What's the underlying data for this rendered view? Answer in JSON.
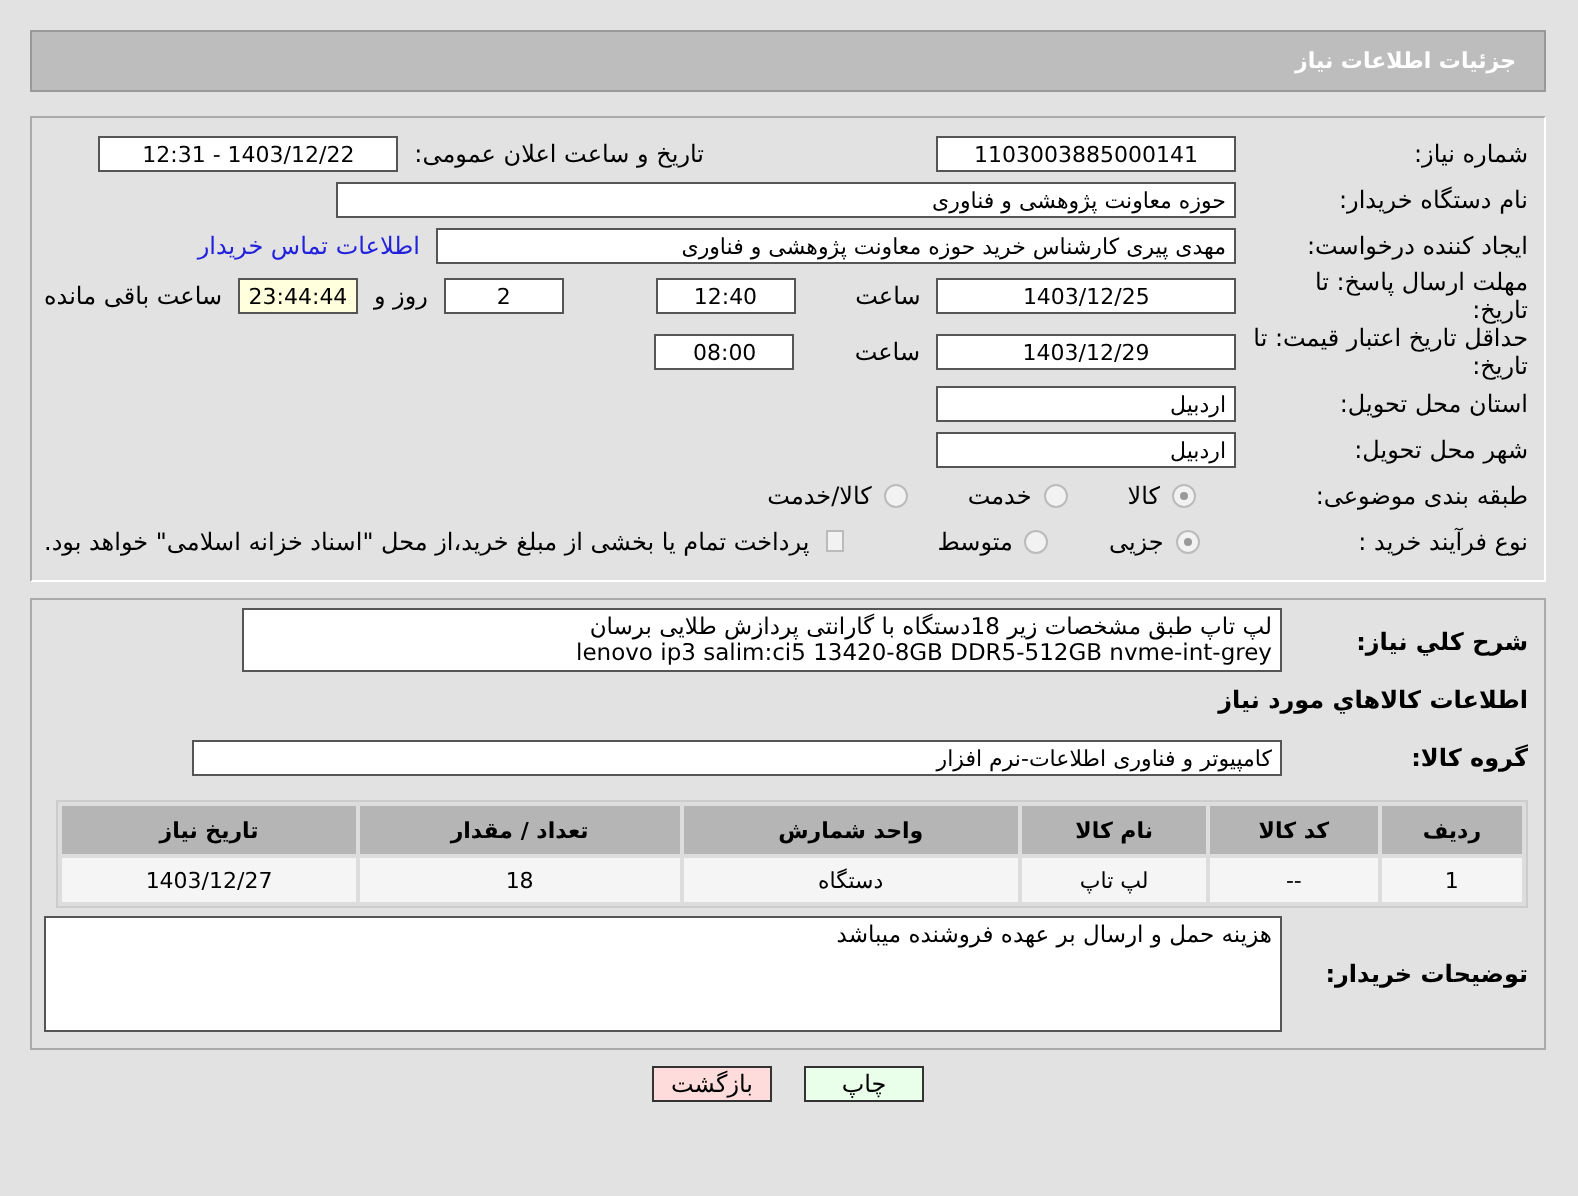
{
  "header": {
    "title": "جزئیات اطلاعات نیاز"
  },
  "fields": {
    "need_number": {
      "label": "شماره نیاز:",
      "value": "1103003885000141"
    },
    "announce": {
      "label": "تاریخ و ساعت اعلان عمومی:",
      "value": "1403/12/22 - 12:31"
    },
    "buyer_org": {
      "label": "نام دستگاه خریدار:",
      "value": "حوزه معاونت پژوهشی و فناوری"
    },
    "creator": {
      "label": "ایجاد کننده درخواست:",
      "value": "مهدی پیری کارشناس خرید حوزه معاونت پژوهشی و فناوری",
      "link": "اطلاعات تماس خریدار"
    },
    "deadline": {
      "label": "مهلت ارسال پاسخ: تا تاریخ:",
      "date": "1403/12/25",
      "time_label": "ساعت",
      "time": "12:40",
      "days": "2",
      "days_label": "روز و",
      "remaining": "23:44:44",
      "remaining_label": "ساعت باقی مانده"
    },
    "validity": {
      "label": "حداقل تاریخ اعتبار قیمت: تا تاریخ:",
      "date": "1403/12/29",
      "time_label": "ساعت",
      "time": "08:00"
    },
    "province": {
      "label": "استان محل تحویل:",
      "value": "اردبیل"
    },
    "city": {
      "label": "شهر محل تحویل:",
      "value": "اردبیل"
    },
    "category": {
      "label": "طبقه بندی موضوعی:",
      "options": [
        {
          "label": "کالا",
          "selected": true
        },
        {
          "label": "خدمت",
          "selected": false
        },
        {
          "label": "کالا/خدمت",
          "selected": false
        }
      ]
    },
    "process": {
      "label": "نوع فرآیند خرید :",
      "options": [
        {
          "label": "جزیی",
          "selected": true
        },
        {
          "label": "متوسط",
          "selected": false
        }
      ],
      "checkbox": {
        "label": "پرداخت تمام یا بخشی از مبلغ خرید،از محل \"اسناد خزانه اسلامی\" خواهد بود.",
        "checked": false
      }
    }
  },
  "description": {
    "label": "شرح کلي نياز:",
    "lines": [
      "لپ تاپ طبق مشخصات زیر 18دستگاه با گارانتی پردازش طلایی برسان",
      "lenovo  ip3 salim:ci5 13420-8GB DDR5-512GB nvme-int-grey"
    ]
  },
  "goods_title": "اطلاعات کالاهاي مورد نياز",
  "goods_group": {
    "label": "گروه کالا:",
    "value": "کامپیوتر و فناوری اطلاعات-نرم افزار"
  },
  "table": {
    "columns": [
      "ردیف",
      "کد کالا",
      "نام کالا",
      "واحد شمارش",
      "تعداد / مقدار",
      "تاریخ نیاز"
    ],
    "rows": [
      [
        "1",
        "--",
        "لپ تاپ",
        "دستگاه",
        "18",
        "1403/12/27"
      ]
    ]
  },
  "buyer_notes": {
    "label": "توضیحات خریدار:",
    "value": "هزینه حمل و ارسال بر عهده فروشنده میباشد"
  },
  "buttons": [
    {
      "label": "چاپ",
      "kind": "print"
    },
    {
      "label": "بازگشت",
      "kind": "back"
    }
  ]
}
